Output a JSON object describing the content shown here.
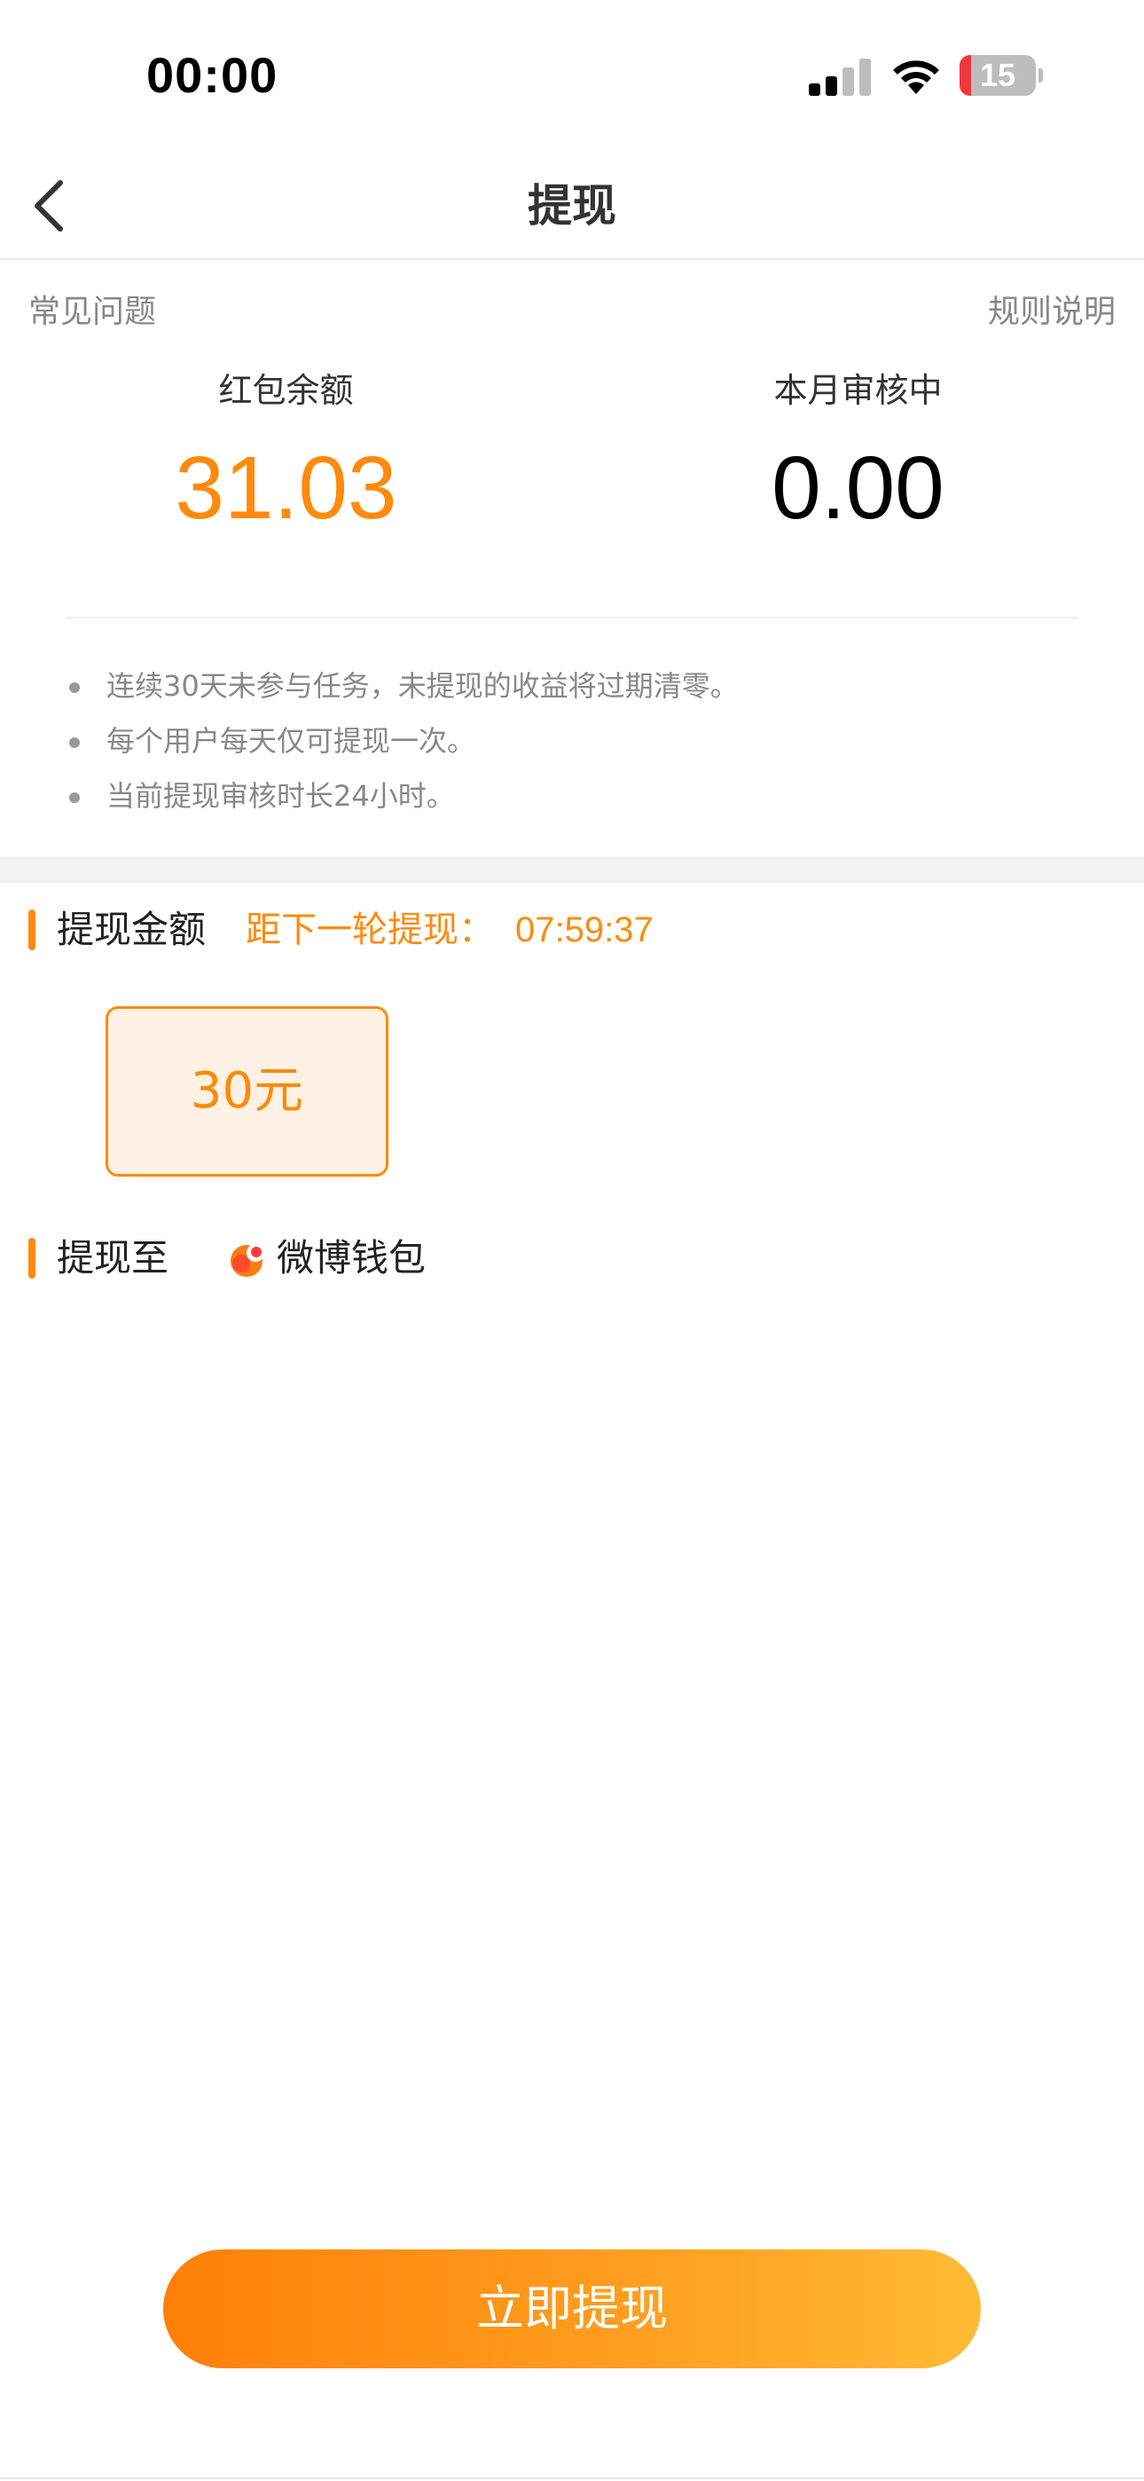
{
  "status_bar": {
    "time": "00:00",
    "battery_level": "15",
    "battery_fill_fraction": 0.15,
    "icons": [
      "cellular-signal-icon",
      "wifi-icon",
      "battery-icon"
    ]
  },
  "nav": {
    "title": "提现",
    "back_icon": "chevron-left-icon"
  },
  "links": {
    "faq": "常见问题",
    "rules": "规则说明"
  },
  "balance": {
    "red_packet_label": "红包余额",
    "red_packet_value": "31.03",
    "reviewing_label": "本月审核中",
    "reviewing_value": "0.00"
  },
  "notes": [
    "连续30天未参与任务，未提现的收益将过期清零。",
    "每个用户每天仅可提现一次。",
    "当前提现审核时长24小时。"
  ],
  "amount_section": {
    "title": "提现金额",
    "countdown_label": "距下一轮提现：",
    "countdown_time": "07:59:37",
    "options": [
      "30元"
    ],
    "selected_option": "30元"
  },
  "destination": {
    "title": "提现至",
    "wallet_name": "微博钱包",
    "wallet_icon": "weibo-wallet-icon"
  },
  "submit": {
    "label": "立即提现"
  },
  "colors": {
    "accent": "#ff8a0c",
    "accent_light_bg": "#fff1e4",
    "battery_low": "#f0373d"
  }
}
